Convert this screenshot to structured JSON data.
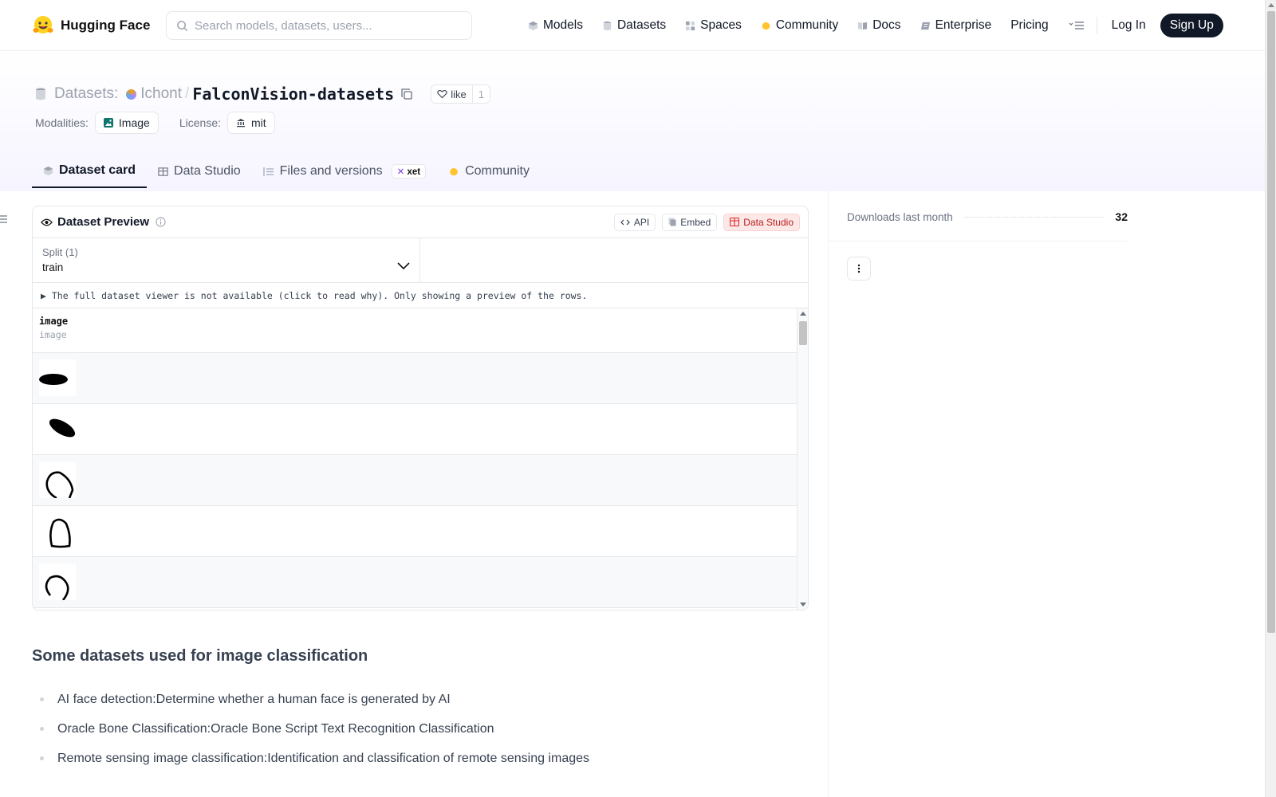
{
  "brand": {
    "name": "Hugging Face"
  },
  "search": {
    "placeholder": "Search models, datasets, users..."
  },
  "nav": {
    "items": [
      {
        "label": "Models",
        "icon": "cube-icon"
      },
      {
        "label": "Datasets",
        "icon": "database-icon"
      },
      {
        "label": "Spaces",
        "icon": "grid-icon"
      },
      {
        "label": "Community",
        "icon": "community-icon"
      },
      {
        "label": "Docs",
        "icon": "book-icon"
      },
      {
        "label": "Enterprise",
        "icon": "enterprise-icon"
      },
      {
        "label": "Pricing"
      }
    ],
    "login": "Log In",
    "signup": "Sign Up"
  },
  "repo": {
    "type_label": "Datasets:",
    "org": "Ichont",
    "separator": "/",
    "name": "FalconVision-datasets",
    "like_label": "like",
    "like_count": "1"
  },
  "meta": {
    "modalities_label": "Modalities:",
    "modality": "Image",
    "license_label": "License:",
    "license": "mit"
  },
  "tabs": [
    {
      "label": "Dataset card",
      "active": true
    },
    {
      "label": "Data Studio"
    },
    {
      "label": "Files and versions",
      "badge": "xet"
    },
    {
      "label": "Community"
    }
  ],
  "preview": {
    "title": "Dataset Preview",
    "buttons": {
      "api": "API",
      "embed": "Embed",
      "studio": "Data Studio"
    },
    "split_label": "Split (1)",
    "split_value": "train",
    "notice": "▶ The full dataset viewer is not available (click to read why). Only showing a preview of the rows.",
    "column": {
      "name": "image",
      "type": "image"
    },
    "rows": [
      "blob-horizontal",
      "blob-diagonal",
      "open-loop",
      "closed-loop",
      "loop-small"
    ]
  },
  "card": {
    "heading": "Some datasets used for image classification",
    "items": [
      "AI face detection:Determine whether a human face is generated by AI",
      "Oracle Bone Classification:Oracle Bone Script Text Recognition Classification",
      "Remote sensing image classification:Identification and classification of remote sensing images"
    ]
  },
  "sidebar": {
    "downloads_label": "Downloads last month",
    "downloads_value": "32"
  },
  "colors": {
    "accent_dark": "#111827",
    "studio_red": "#b91c1c",
    "header_tint": "#f6f4ff"
  }
}
